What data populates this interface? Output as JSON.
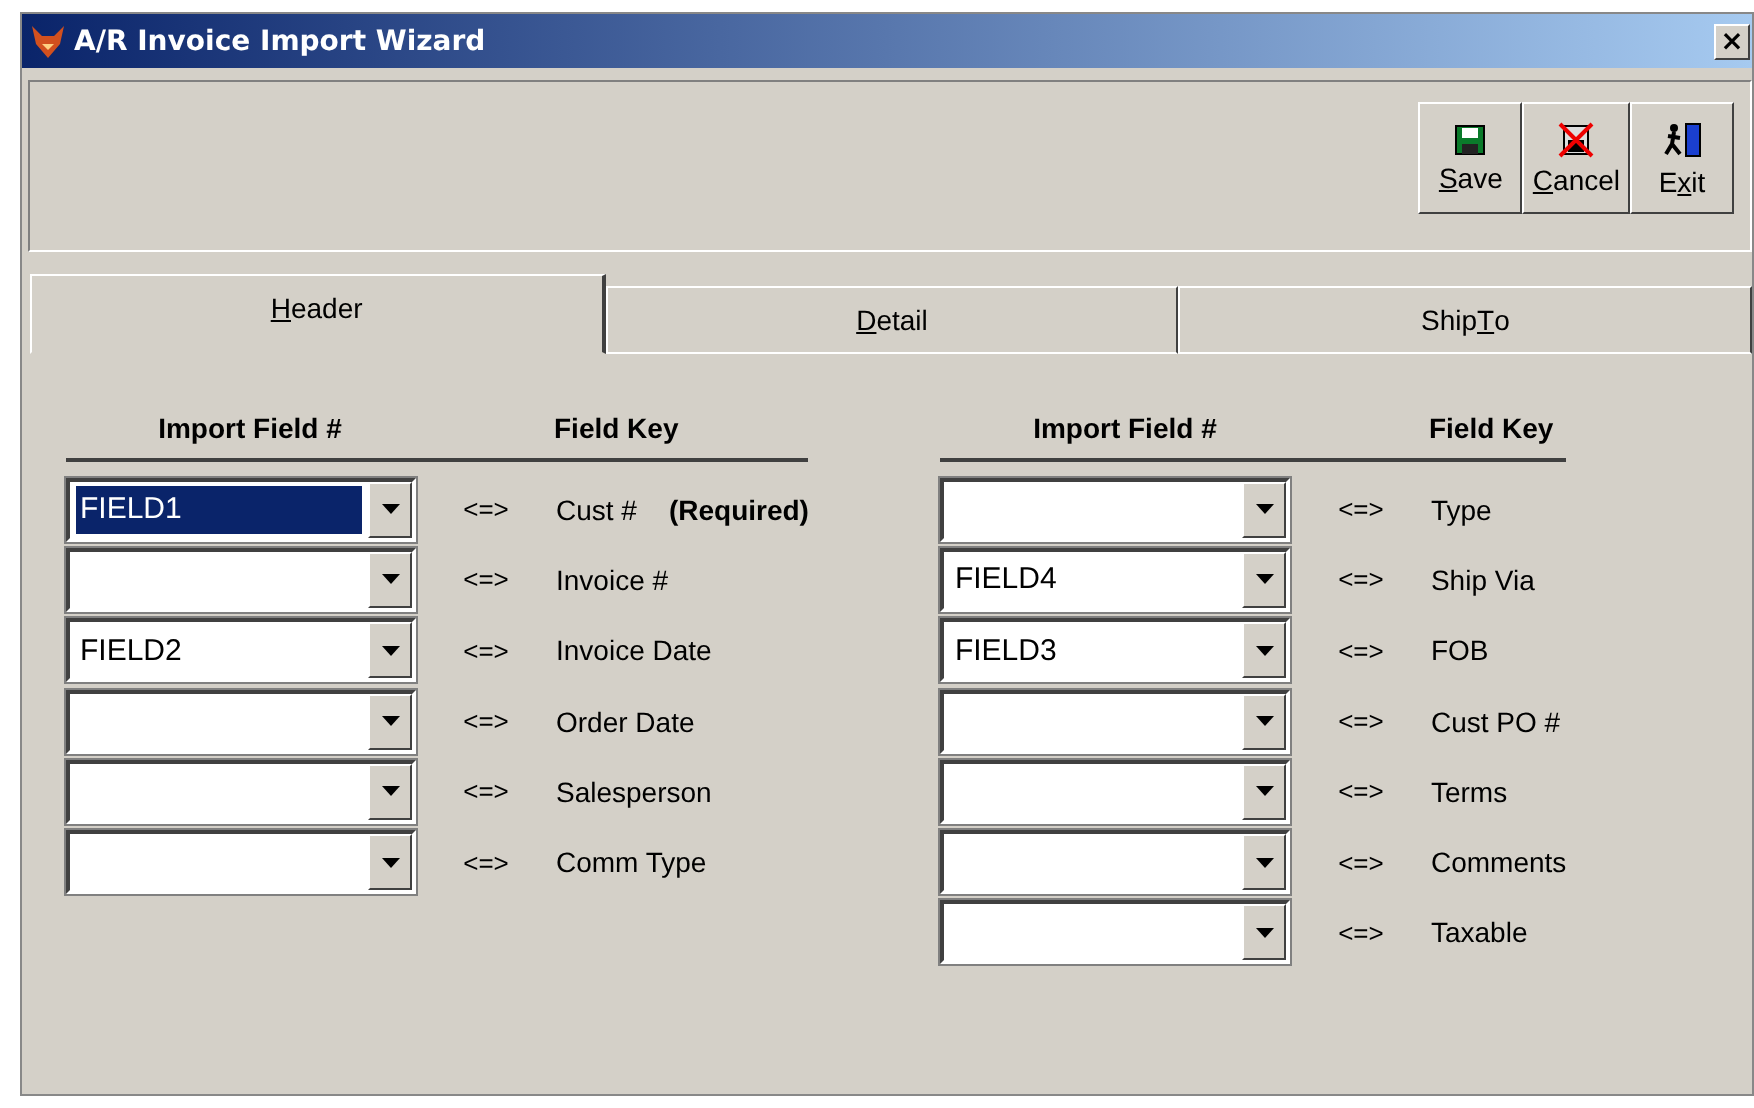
{
  "window": {
    "title": "A/R Invoice Import Wizard",
    "close": "×"
  },
  "toolbar": [
    {
      "kind": "save",
      "label_parts": [
        {
          "text": "S",
          "underlined": true
        },
        {
          "text": "ave",
          "underlined": false
        }
      ]
    },
    {
      "kind": "cancel",
      "label_parts": [
        {
          "text": "C",
          "underlined": true
        },
        {
          "text": "ancel",
          "underlined": false
        }
      ]
    },
    {
      "kind": "exit",
      "label_parts": [
        {
          "text": "E",
          "underlined": false
        },
        {
          "text": "x",
          "underlined": true
        },
        {
          "text": "it",
          "underlined": false
        }
      ]
    }
  ],
  "tabs": [
    {
      "label_parts": [
        {
          "text": "H",
          "underlined": true
        },
        {
          "text": "eader",
          "underlined": false
        }
      ],
      "selected": true
    },
    {
      "label_parts": [
        {
          "text": "D",
          "underlined": true
        },
        {
          "text": "etail",
          "underlined": false
        }
      ],
      "selected": false
    },
    {
      "label_parts": [
        {
          "text": "Ship",
          "underlined": false
        },
        {
          "text": "T",
          "underlined": true
        },
        {
          "text": "o",
          "underlined": false
        }
      ],
      "selected": false
    }
  ],
  "mapping_groups": [
    {
      "column_headers": [
        "Import Field #",
        "Field Key"
      ],
      "rows": [
        {
          "value": "FIELD1",
          "focused": true,
          "arrow": "<=>",
          "key": "Cust #",
          "note": "(Required)"
        },
        {
          "value": "",
          "focused": false,
          "arrow": "<=>",
          "key": "Invoice #"
        },
        {
          "value": "FIELD2",
          "focused": false,
          "arrow": "<=>",
          "key": "Invoice Date"
        },
        {
          "value": "",
          "focused": false,
          "arrow": "<=>",
          "key": "Order Date"
        },
        {
          "value": "",
          "focused": false,
          "arrow": "<=>",
          "key": "Salesperson"
        },
        {
          "value": "",
          "focused": false,
          "arrow": "<=>",
          "key": "Comm Type"
        }
      ]
    },
    {
      "column_headers": [
        "Import Field #",
        "Field Key"
      ],
      "rows": [
        {
          "value": "",
          "focused": false,
          "arrow": "<=>",
          "key": "Type"
        },
        {
          "value": "FIELD4",
          "focused": false,
          "arrow": "<=>",
          "key": "Ship Via"
        },
        {
          "value": "FIELD3",
          "focused": false,
          "arrow": "<=>",
          "key": "FOB"
        },
        {
          "value": "",
          "focused": false,
          "arrow": "<=>",
          "key": "Cust PO #"
        },
        {
          "value": "",
          "focused": false,
          "arrow": "<=>",
          "key": "Terms"
        },
        {
          "value": "",
          "focused": false,
          "arrow": "<=>",
          "key": "Comments"
        },
        {
          "value": "",
          "focused": false,
          "arrow": "<=>",
          "key": "Taxable"
        }
      ]
    }
  ]
}
